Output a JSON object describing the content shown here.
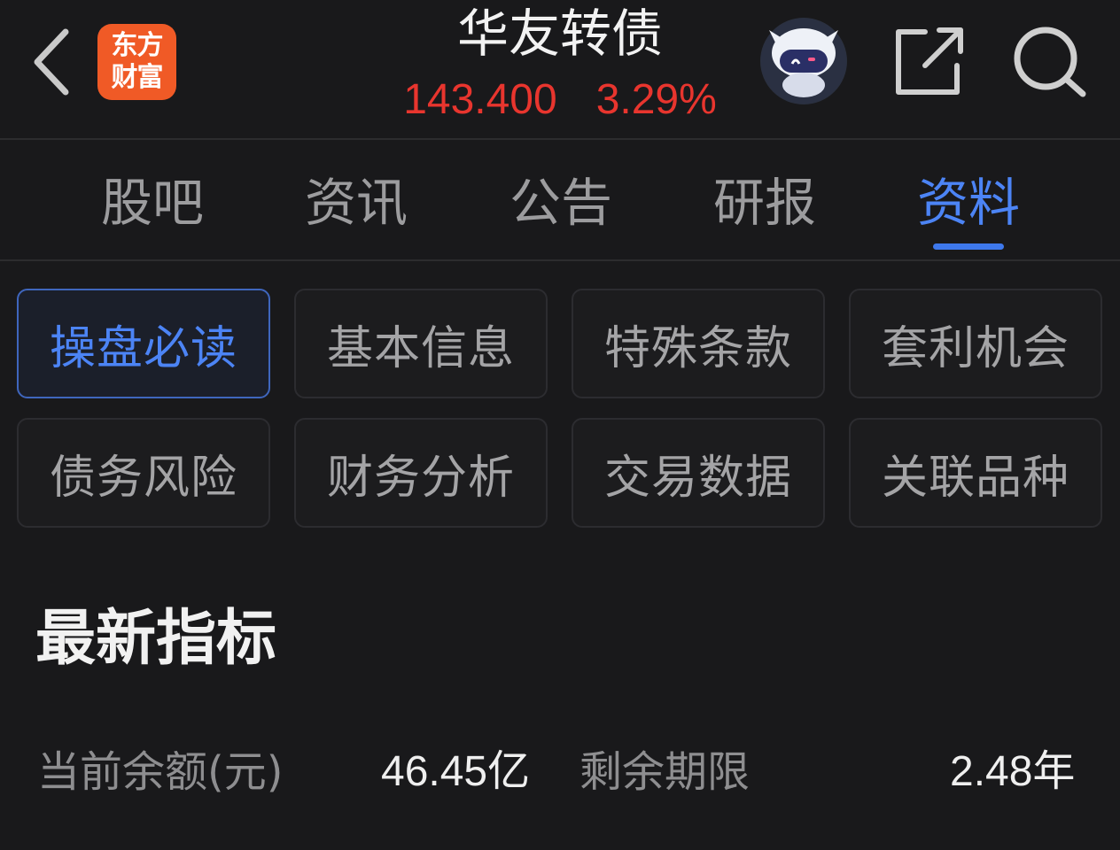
{
  "header": {
    "logo_line1": "东方",
    "logo_line2": "财富",
    "title": "华友转债",
    "price": "143.400",
    "change_pct": "3.29%",
    "icons": [
      "back-arrow-icon",
      "robot-assistant-icon",
      "share-icon",
      "search-icon"
    ]
  },
  "tabs": [
    {
      "label": "股吧",
      "active": false
    },
    {
      "label": "资讯",
      "active": false
    },
    {
      "label": "公告",
      "active": false
    },
    {
      "label": "研报",
      "active": false
    },
    {
      "label": "资料",
      "active": true
    }
  ],
  "sub_tabs": [
    {
      "label": "操盘必读",
      "selected": true
    },
    {
      "label": "基本信息",
      "selected": false
    },
    {
      "label": "特殊条款",
      "selected": false
    },
    {
      "label": "套利机会",
      "selected": false
    },
    {
      "label": "债务风险",
      "selected": false
    },
    {
      "label": "财务分析",
      "selected": false
    },
    {
      "label": "交易数据",
      "selected": false
    },
    {
      "label": "关联品种",
      "selected": false
    }
  ],
  "latest": {
    "title": "最新指标",
    "metrics": [
      {
        "label": "当前余额(元)",
        "value": "46.45亿"
      },
      {
        "label": "剩余期限",
        "value": "2.48年"
      }
    ]
  },
  "colors": {
    "background": "#19191b",
    "up_red": "#e8352e",
    "accent_blue": "#4c84f5",
    "logo_orange": "#f05a26"
  }
}
